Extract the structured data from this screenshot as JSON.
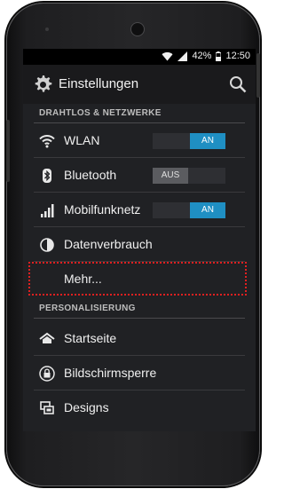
{
  "statusbar": {
    "battery": "42%",
    "time": "12:50"
  },
  "actionbar": {
    "title": "Einstellungen"
  },
  "sections": [
    {
      "title": "DRAHTLOS & NETZWERKE"
    },
    {
      "title": "PERSONALISIERUNG"
    }
  ],
  "wireless_items": [
    {
      "label": "WLAN",
      "icon": "wifi-icon",
      "toggle": "AN"
    },
    {
      "label": "Bluetooth",
      "icon": "bluetooth-icon",
      "toggle": "AUS"
    },
    {
      "label": "Mobilfunknetz",
      "icon": "signal-icon",
      "toggle": "AN"
    },
    {
      "label": "Datenverbrauch",
      "icon": "data-usage-icon"
    },
    {
      "label": "Mehr...",
      "icon": ""
    }
  ],
  "personal_items": [
    {
      "label": "Startseite",
      "icon": "home-icon"
    },
    {
      "label": "Bildschirmsperre",
      "icon": "lock-icon"
    },
    {
      "label": "Designs",
      "icon": "themes-icon"
    }
  ],
  "colors": {
    "accent": "#1f8fc3",
    "highlight": "#e02020",
    "background": "#202124"
  }
}
